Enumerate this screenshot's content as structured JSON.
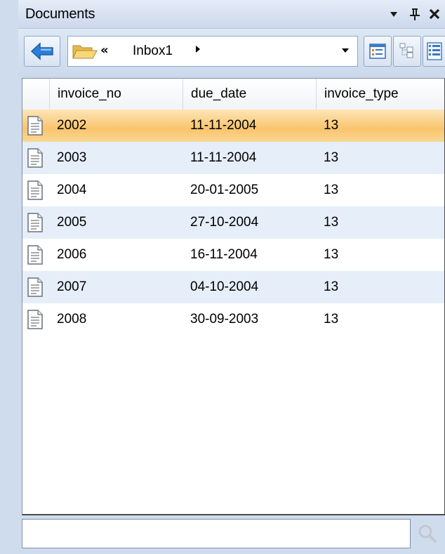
{
  "panel": {
    "title": "Documents",
    "dropdown_glyph": "▾",
    "pin_glyph": "ꟷ",
    "close_glyph": "✕"
  },
  "toolbar": {
    "back_icon": "back-arrow-icon",
    "address": {
      "folder_icon": "open-folder-icon",
      "overflow_glyph": "«",
      "crumb": "Inbox1",
      "crumb_arrow": "▸",
      "dropdown_glyph": "▾"
    },
    "view_buttons": [
      "details-view-icon",
      "tree-view-icon",
      "list-view-icon"
    ]
  },
  "table": {
    "columns": [
      "invoice_no",
      "due_date",
      "invoice_type"
    ],
    "rows": [
      {
        "invoice_no": "2002",
        "due_date": "11-11-2004",
        "invoice_type": "13",
        "selected": true
      },
      {
        "invoice_no": "2003",
        "due_date": "11-11-2004",
        "invoice_type": "13"
      },
      {
        "invoice_no": "2004",
        "due_date": "20-01-2005",
        "invoice_type": "13"
      },
      {
        "invoice_no": "2005",
        "due_date": "27-10-2004",
        "invoice_type": "13"
      },
      {
        "invoice_no": "2006",
        "due_date": "16-11-2004",
        "invoice_type": "13"
      },
      {
        "invoice_no": "2007",
        "due_date": "04-10-2004",
        "invoice_type": "13"
      },
      {
        "invoice_no": "2008",
        "due_date": "30-09-2003",
        "invoice_type": "13"
      }
    ]
  },
  "search": {
    "value": "",
    "placeholder": "",
    "icon": "magnifier-icon"
  },
  "colors": {
    "selected_row": "#f9c46c",
    "alt_row": "#e6eef9",
    "accent_blue": "#2f7fd8"
  }
}
